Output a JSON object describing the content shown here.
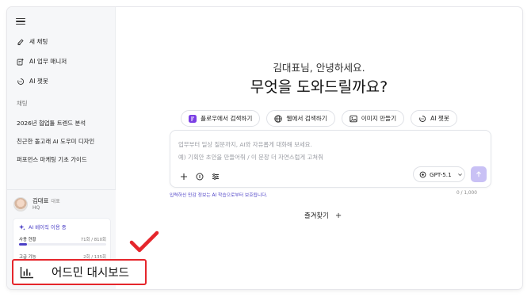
{
  "sidebar": {
    "items": [
      {
        "label": "새 채팅",
        "icon": "edit-icon"
      },
      {
        "label": "AI 업무 매니저",
        "icon": "tasks-icon"
      },
      {
        "label": "AI 챗봇",
        "icon": "bot-icon"
      }
    ],
    "section_label": "채팅",
    "chats": [
      "2026년 협업툴 트렌드 분석",
      "친근한 돌고래 AI 도우미 디자인",
      "퍼포먼스 마케팅 기초 가이드"
    ],
    "profile": {
      "name": "김대표",
      "role": "대표",
      "org": "HQ",
      "usage_title": "AI 베이직 이용 중",
      "usage": [
        {
          "label": "사용 현황",
          "value": "71회 / 810회",
          "fraction": 0.088
        },
        {
          "label": "고급 기능",
          "value": "2회 / 135회",
          "fraction": 0.015
        }
      ]
    },
    "admin_dashboard_label": "어드민 대시보드"
  },
  "main": {
    "greeting": "김대표님, 안녕하세요.",
    "headline": "무엇을 도와드릴까요?",
    "actions": [
      {
        "label": "플로우에서 검색하기",
        "icon": "flow-icon"
      },
      {
        "label": "웹에서 검색하기",
        "icon": "globe-icon"
      },
      {
        "label": "이미지 만들기",
        "icon": "image-icon"
      },
      {
        "label": "AI 챗봇",
        "icon": "bot-icon"
      }
    ],
    "composer": {
      "placeholder_line1": "업무부터 일상 질문까지, AI와 자유롭게 대화해 보세요.",
      "placeholder_line2": "예) 기획안 초안을 만들어줘 / 이 문장 더 자연스럽게 고쳐줘",
      "model": "GPT-5.1",
      "privacy_note": "입력하신 민감 정보는 AI 학습으로부터 보호됩니다.",
      "char_count": "0 / 1,000"
    },
    "favorites_label": "즐겨찾기",
    "favorites_add": "+"
  },
  "colors": {
    "accent": "#4b3fc6",
    "highlight_box": "#e5262c",
    "send_button": "#c9c1f5"
  }
}
